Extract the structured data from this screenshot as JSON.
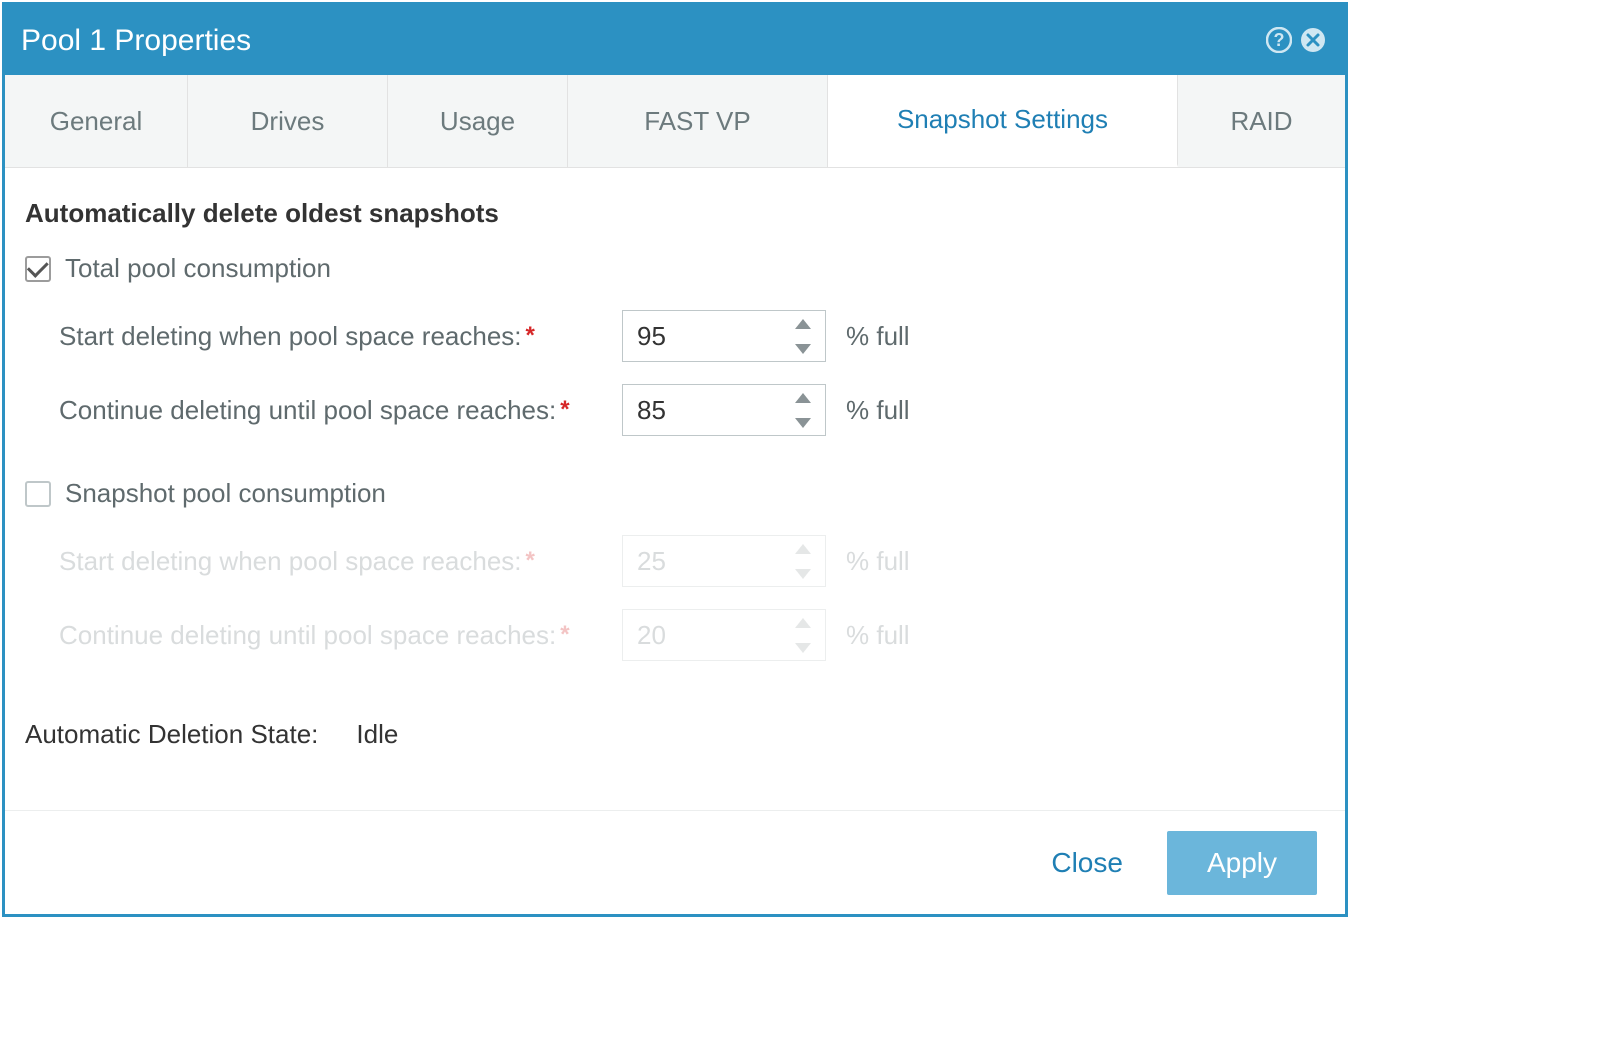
{
  "dialog": {
    "title": "Pool 1 Properties"
  },
  "tabs": {
    "general": "General",
    "drives": "Drives",
    "usage": "Usage",
    "fastvp": "FAST VP",
    "snapshot": "Snapshot Settings",
    "raid": "RAID"
  },
  "snapshot": {
    "heading": "Automatically delete oldest snapshots",
    "totalPool": {
      "label": "Total pool consumption",
      "checked": true,
      "startLabel": "Start deleting when pool space reaches:",
      "startValue": "95",
      "continueLabel": "Continue deleting until pool space reaches:",
      "continueValue": "85",
      "unit": "% full"
    },
    "snapshotPool": {
      "label": "Snapshot pool consumption",
      "checked": false,
      "startLabel": "Start deleting when pool space reaches:",
      "startValue": "25",
      "continueLabel": "Continue deleting until pool space reaches:",
      "continueValue": "20",
      "unit": "% full"
    },
    "stateLabel": "Automatic Deletion State:",
    "stateValue": "Idle",
    "required": "*"
  },
  "footer": {
    "close": "Close",
    "apply": "Apply"
  }
}
